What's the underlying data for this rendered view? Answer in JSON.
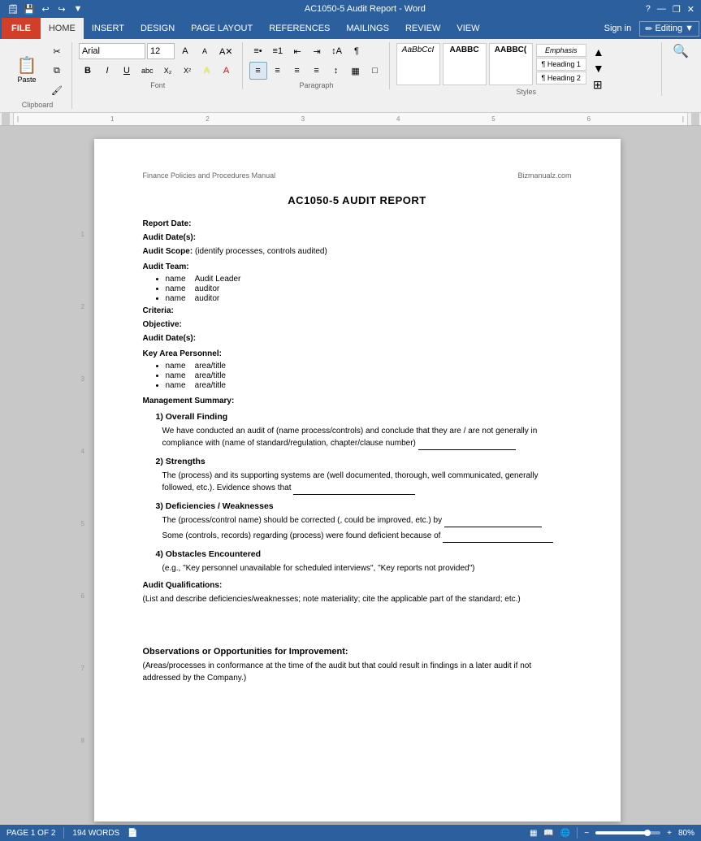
{
  "titleBar": {
    "title": "AC1050-5 Audit Report - Word",
    "helpLabel": "?",
    "minimizeLabel": "—",
    "restoreLabel": "❐",
    "closeLabel": "✕"
  },
  "menuBar": {
    "fileLabel": "FILE",
    "tabs": [
      "HOME",
      "INSERT",
      "DESIGN",
      "PAGE LAYOUT",
      "REFERENCES",
      "MAILINGS",
      "REVIEW",
      "VIEW"
    ],
    "activeTab": "HOME",
    "signIn": "Sign in",
    "editingLabel": "Editing"
  },
  "ribbon": {
    "clipboard": {
      "label": "Clipboard",
      "pasteLabel": "Paste",
      "cutLabel": "✂",
      "copyLabel": "⧉",
      "formatPainterLabel": "🖌"
    },
    "font": {
      "label": "Font",
      "fontName": "Arial",
      "fontSize": "12",
      "growLabel": "A",
      "shrinkLabel": "A",
      "clearLabel": "A",
      "boldLabel": "B",
      "italicLabel": "I",
      "underlineLabel": "U",
      "strikeLabel": "abc",
      "subLabel": "X₂",
      "supLabel": "X²",
      "textColorLabel": "A",
      "highlightLabel": "A"
    },
    "paragraph": {
      "label": "Paragraph",
      "bulletLabel": "≡",
      "numberLabel": "≡",
      "decreaseLabel": "←",
      "increaseLabel": "→",
      "sortLabel": "↕",
      "showLabel": "¶",
      "alignLeftLabel": "≡",
      "alignCenterLabel": "≡",
      "alignRightLabel": "≡",
      "justifyLabel": "≡",
      "lineSpacingLabel": "↕",
      "shadingLabel": "■",
      "borderLabel": "□"
    },
    "styles": {
      "label": "Styles",
      "items": [
        "AaBbCcI",
        "AABBC",
        "AABBC(",
        "Emphasis",
        "¶ Heading 1",
        "¶ Heading 2"
      ]
    },
    "editing": {
      "label": "",
      "findLabel": "🔍"
    }
  },
  "document": {
    "headerLeft": "Finance Policies and Procedures Manual",
    "headerRight": "Bizmanualz.com",
    "title": "AC1050-5 AUDIT REPORT",
    "fields": [
      {
        "label": "Report Date:",
        "value": ""
      },
      {
        "label": "Audit Date(s):",
        "value": ""
      },
      {
        "label": "Audit Scope:",
        "value": "(identify processes, controls audited)"
      }
    ],
    "auditTeam": {
      "heading": "Audit Team:",
      "members": [
        {
          "name": "name",
          "role": "Audit Leader"
        },
        {
          "name": "name",
          "role": "auditor"
        },
        {
          "name": "name",
          "role": "auditor"
        }
      ]
    },
    "sections": [
      {
        "label": "Criteria:",
        "value": ""
      },
      {
        "label": "Objective:",
        "value": ""
      },
      {
        "label": "Audit Date(s):",
        "value": ""
      }
    ],
    "keyPersonnel": {
      "heading": "Key Area Personnel:",
      "members": [
        {
          "name": "name",
          "role": "area/title"
        },
        {
          "name": "name",
          "role": "area/title"
        },
        {
          "name": "name",
          "role": "area/title"
        }
      ]
    },
    "managementSummary": {
      "heading": "Management Summary:",
      "subsections": [
        {
          "heading": "1) Overall Finding",
          "text": "We have conducted an audit of (name process/controls) and conclude that they are / are not generally in compliance with (name of standard/regulation, chapter/clause number)"
        },
        {
          "heading": "2) Strengths",
          "text": "The (process) and its supporting systems are (well documented, thorough, well communicated, generally followed, etc.).  Evidence shows that"
        },
        {
          "heading": "3) Deficiencies / Weaknesses",
          "lines": [
            "The (process/control name) should be corrected (, could be improved, etc.) by",
            "Some (controls, records) regarding (process) were found deficient because of"
          ]
        },
        {
          "heading": "4) Obstacles Encountered",
          "text": "(e.g., \"Key personnel unavailable for scheduled interviews\", \"Key reports not provided\")"
        }
      ]
    },
    "auditQualifications": {
      "heading": "Audit Qualifications:",
      "text": "(List and describe deficiencies/weaknesses; note materiality; cite the applicable part of the standard; etc.)"
    },
    "observations": {
      "heading": "Observations or Opportunities for Improvement:",
      "text": "(Areas/processes in conformance at the time of the audit but that could result in findings in a later audit if not addressed by the Company.)"
    }
  },
  "statusBar": {
    "pageInfo": "PAGE 1 OF 2",
    "wordCount": "194 WORDS",
    "zoom": "80%",
    "zoomMinus": "−",
    "zoomPlus": "+"
  }
}
